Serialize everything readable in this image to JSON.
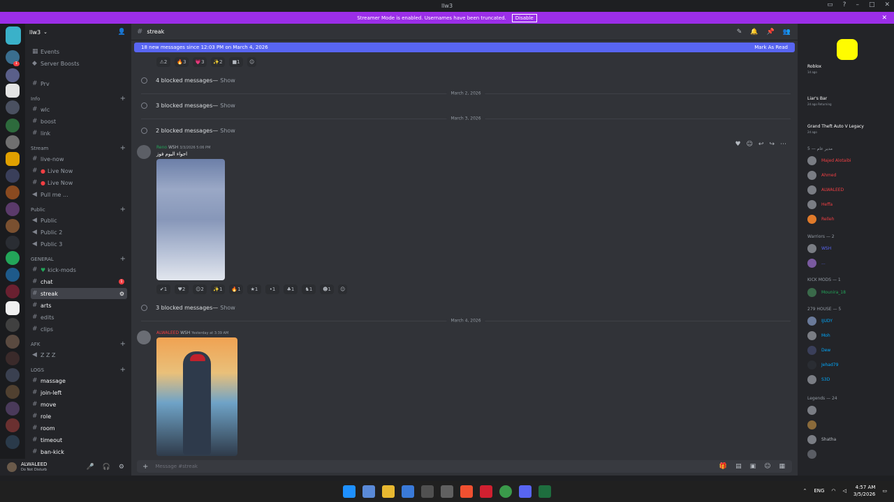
{
  "window": {
    "title": "llw3"
  },
  "banner": {
    "text": "Streamer Mode is enabled. Usernames have been truncated.",
    "button": "Disable"
  },
  "server": {
    "name": "llw3",
    "logo_text": "OUTLAW RP"
  },
  "sidebar": {
    "top_items": [
      "Events",
      "Server Boosts",
      "Prv"
    ],
    "categories": [
      {
        "name": "Info",
        "channels": [
          "wlc",
          "boost",
          "link"
        ]
      },
      {
        "name": "Stream",
        "channels": [
          "live-now",
          "Live Now",
          "Live Now",
          "Pull me ..."
        ]
      },
      {
        "name": "Public",
        "channels": [
          "Public",
          "Public 2",
          "Public 3"
        ]
      },
      {
        "name": "GENERAL",
        "channels": [
          "kick-mods",
          "chat",
          "streak",
          "arts",
          "edits",
          "clips"
        ]
      },
      {
        "name": "AFK",
        "channels": [
          "Z Z Z"
        ]
      },
      {
        "name": "LOGS",
        "channels": [
          "massage",
          "join-left",
          "move",
          "role",
          "room",
          "timeout",
          "ban-kick"
        ]
      }
    ],
    "chat_unread": "1"
  },
  "user": {
    "name": "ALWALEED",
    "status": "Do Not Disturb"
  },
  "chat": {
    "channel": "streak",
    "new_messages": "18 new messages since 12:03 PM on March 4, 2026",
    "mark_read": "Mark As Read",
    "reactions_top": [
      "2",
      "3",
      "3",
      "2",
      "1"
    ],
    "blocked": [
      {
        "count_text": "4 blocked messages",
        "show": "Show"
      },
      {
        "count_text": "3 blocked messages",
        "show": "Show"
      },
      {
        "count_text": "2 blocked messages",
        "show": "Show"
      },
      {
        "count_text": "3 blocked messages",
        "show": "Show"
      }
    ],
    "dates": [
      "March 2, 2026",
      "March 3, 2026",
      "March 4, 2026"
    ],
    "message1": {
      "author": "Reno",
      "tag": "WSH",
      "time": "3/3/2026 5:06 PM",
      "text": "اجواء اليوم فوز"
    },
    "reactions_mid": [
      "1",
      "2",
      "2",
      "1",
      "1",
      "1",
      "1",
      "1",
      "1",
      "1"
    ],
    "message2": {
      "author": "ALWALEED",
      "tag": "WSH",
      "time": "Yesterday at 3:39 AM"
    },
    "composer_placeholder": "Message #streak"
  },
  "members": {
    "activities": [
      {
        "name": "Roblox",
        "sub": "1d ago"
      },
      {
        "name": "Liar's Bar",
        "sub": "2d ago  Returning"
      },
      {
        "name": "Grand Theft Auto V Legacy",
        "sub": "2d ago"
      }
    ],
    "groups": [
      {
        "title": "مدير عام — 5",
        "members": [
          "Majed Alotaibi",
          "Ahmed",
          "ALWALEED",
          "Heffa",
          "Relleh"
        ],
        "colors": [
          "#f23f43",
          "#f23f43",
          "#f23f43",
          "#f23f43",
          "#f23f43"
        ]
      },
      {
        "title": "Warriors — 2",
        "members": [
          "WSH",
          "..."
        ],
        "colors": [
          "#5865f2",
          "#5865f2"
        ]
      },
      {
        "title": "KICK MODS — 1",
        "members": [
          "Mounira_18"
        ],
        "colors": [
          "#23a559"
        ]
      },
      {
        "title": "279 HOUSE — 5",
        "members": [
          "IJUDY",
          "Moh",
          "Dew",
          "Jehad79",
          "S3D"
        ],
        "colors": [
          "#00a8fc",
          "#00a8fc",
          "#00a8fc",
          "#00a8fc",
          "#00a8fc"
        ]
      },
      {
        "title": "Legends — 24",
        "members": [
          "",
          "",
          "Shatha",
          ""
        ],
        "colors": [
          "#b5bac1",
          "#b5bac1",
          "#b5bac1",
          "#b5bac1"
        ]
      }
    ]
  },
  "taskbar": {
    "lang": "ENG",
    "time": "4:57 AM",
    "date": "3/5/2026"
  }
}
